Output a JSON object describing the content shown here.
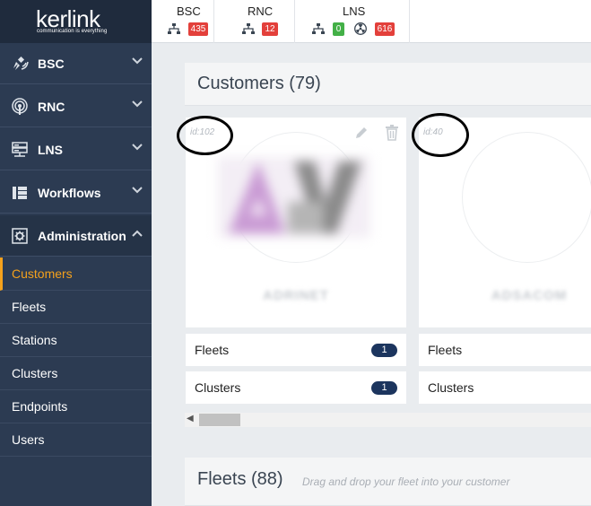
{
  "brand": {
    "name": "kerlink",
    "tagline": "communication is everything"
  },
  "sidebar": {
    "sections": [
      {
        "label": "BSC",
        "icon": "satellite-icon",
        "expanded": false
      },
      {
        "label": "RNC",
        "icon": "signal-icon",
        "expanded": false
      },
      {
        "label": "LNS",
        "icon": "server-icon",
        "expanded": false
      },
      {
        "label": "Workflows",
        "icon": "workflow-icon",
        "expanded": false
      },
      {
        "label": "Administration",
        "icon": "gear-icon",
        "expanded": true
      }
    ],
    "items": [
      {
        "label": "Customers",
        "active": true
      },
      {
        "label": "Fleets",
        "active": false
      },
      {
        "label": "Stations",
        "active": false
      },
      {
        "label": "Clusters",
        "active": false
      },
      {
        "label": "Endpoints",
        "active": false
      },
      {
        "label": "Users",
        "active": false
      }
    ]
  },
  "topbar": {
    "bsc": {
      "name": "BSC",
      "count": "435"
    },
    "rnc": {
      "name": "RNC",
      "count": "12"
    },
    "lns": {
      "name": "LNS",
      "ok": "0",
      "alert": "616"
    }
  },
  "customers": {
    "title": "Customers (79)",
    "cards": [
      {
        "id": "id:102",
        "name": "ADRINET",
        "fleets_label": "Fleets",
        "fleets_count": "1",
        "clusters_label": "Clusters",
        "clusters_count": "1"
      },
      {
        "id": "id:40",
        "name": "ADSACOM",
        "fleets_label": "Fleets",
        "clusters_label": "Clusters"
      }
    ]
  },
  "fleets": {
    "title": "Fleets (88)",
    "hint": "Drag and drop your fleet into your customer"
  },
  "colors": {
    "accent": "#f4a11c",
    "sidebar": "#2c3b52",
    "badge_red": "#e3403b",
    "badge_green": "#43b047",
    "pill": "#1c355e"
  }
}
